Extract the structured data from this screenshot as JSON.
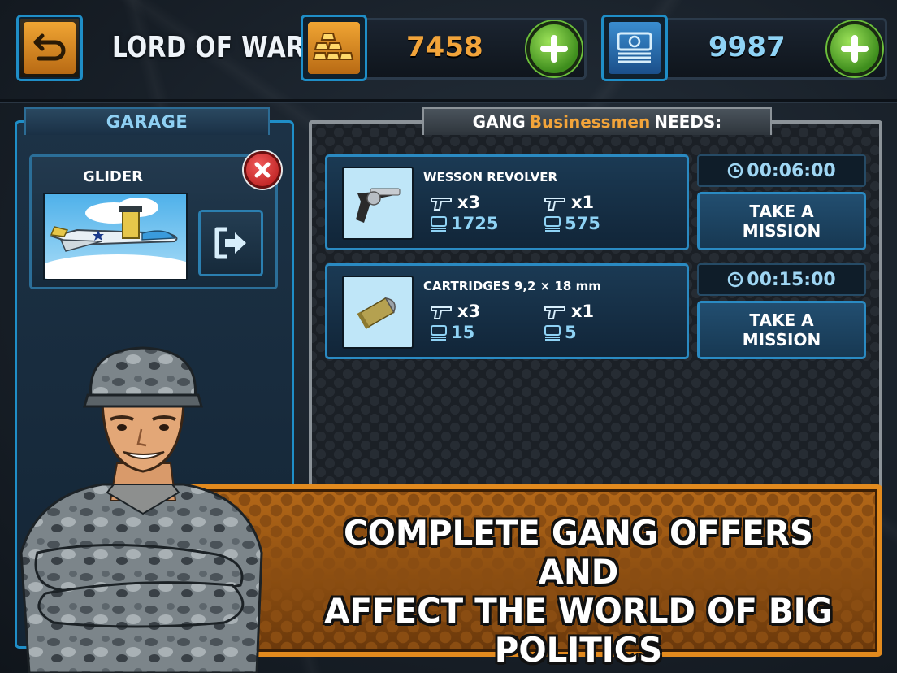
{
  "header": {
    "title": "LORD OF WAR",
    "gold_value": "7458",
    "cash_value": "9987"
  },
  "garage": {
    "tab_label": "GARAGE",
    "vehicle_name": "GLIDER"
  },
  "needs": {
    "prefix": "GANG",
    "gang_name": "Businessmen",
    "suffix": "NEEDS:",
    "missions": [
      {
        "title": "WESSON REVOLVER",
        "qty_left": "x3",
        "price_left": "1725",
        "qty_right": "x1",
        "price_right": "575",
        "timer": "00:06:00",
        "button_line1": "TAKE A",
        "button_line2": "MISSION"
      },
      {
        "title": "CARTRIDGES 9,2 × 18 mm",
        "qty_left": "x3",
        "price_left": "15",
        "qty_right": "x1",
        "price_right": "5",
        "timer": "00:15:00",
        "button_line1": "TAKE A",
        "button_line2": "MISSION"
      }
    ]
  },
  "banner": {
    "line1": "COMPLETE GANG OFFERS AND",
    "line2": "AFFECT THE WORLD OF BIG",
    "line3": "POLITICS"
  },
  "colors": {
    "accent_blue": "#1f8ec7",
    "gold": "#f2a43a",
    "plus_green": "#6bbf3a",
    "close_red": "#d42a2a"
  },
  "icons": [
    "back-arrow-icon",
    "gold-bars-icon",
    "cash-stack-icon",
    "plus-icon",
    "close-icon",
    "export-icon",
    "clock-icon",
    "revolver-icon",
    "coin-icon"
  ]
}
